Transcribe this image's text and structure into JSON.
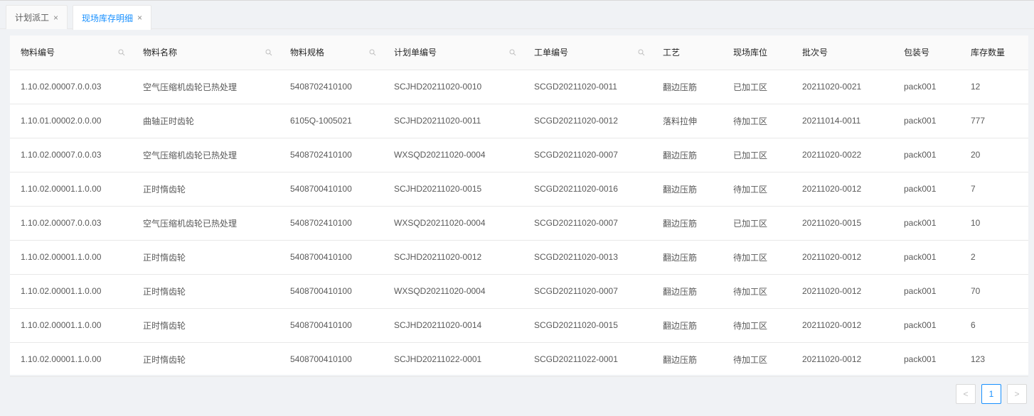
{
  "tabs": [
    {
      "label": "计划派工",
      "close": "×"
    },
    {
      "label": "现场库存明细",
      "close": "×"
    }
  ],
  "table": {
    "columns": [
      "物料编号",
      "物料名称",
      "物料规格",
      "计划单编号",
      "工单编号",
      "工艺",
      "现场库位",
      "批次号",
      "包装号",
      "库存数量"
    ],
    "rows": [
      [
        "1.10.02.00007.0.0.03",
        "空气压缩机齿轮已热处理",
        "5408702410100",
        "SCJHD20211020-0010",
        "SCGD20211020-0011",
        "翻边压筋",
        "已加工区",
        "20211020-0021",
        "pack001",
        "12"
      ],
      [
        "1.10.01.00002.0.0.00",
        "曲轴正时齿轮",
        "6105Q-1005021",
        "SCJHD20211020-0011",
        "SCGD20211020-0012",
        "落料拉伸",
        "待加工区",
        "20211014-0011",
        "pack001",
        "777"
      ],
      [
        "1.10.02.00007.0.0.03",
        "空气压缩机齿轮已热处理",
        "5408702410100",
        "WXSQD20211020-0004",
        "SCGD20211020-0007",
        "翻边压筋",
        "已加工区",
        "20211020-0022",
        "pack001",
        "20"
      ],
      [
        "1.10.02.00001.1.0.00",
        "正时惰齿轮",
        "5408700410100",
        "SCJHD20211020-0015",
        "SCGD20211020-0016",
        "翻边压筋",
        "待加工区",
        "20211020-0012",
        "pack001",
        "7"
      ],
      [
        "1.10.02.00007.0.0.03",
        "空气压缩机齿轮已热处理",
        "5408702410100",
        "WXSQD20211020-0004",
        "SCGD20211020-0007",
        "翻边压筋",
        "已加工区",
        "20211020-0015",
        "pack001",
        "10"
      ],
      [
        "1.10.02.00001.1.0.00",
        "正时惰齿轮",
        "5408700410100",
        "SCJHD20211020-0012",
        "SCGD20211020-0013",
        "翻边压筋",
        "待加工区",
        "20211020-0012",
        "pack001",
        "2"
      ],
      [
        "1.10.02.00001.1.0.00",
        "正时惰齿轮",
        "5408700410100",
        "WXSQD20211020-0004",
        "SCGD20211020-0007",
        "翻边压筋",
        "待加工区",
        "20211020-0012",
        "pack001",
        "70"
      ],
      [
        "1.10.02.00001.1.0.00",
        "正时惰齿轮",
        "5408700410100",
        "SCJHD20211020-0014",
        "SCGD20211020-0015",
        "翻边压筋",
        "待加工区",
        "20211020-0012",
        "pack001",
        "6"
      ],
      [
        "1.10.02.00001.1.0.00",
        "正时惰齿轮",
        "5408700410100",
        "SCJHD20211022-0001",
        "SCGD20211022-0001",
        "翻边压筋",
        "待加工区",
        "20211020-0012",
        "pack001",
        "123"
      ]
    ]
  },
  "pagination": {
    "prev": "<",
    "current": "1",
    "next": ">"
  },
  "colors": {
    "accent": "#1890ff",
    "border": "#e8e8e8",
    "background": "#f0f2f5"
  }
}
